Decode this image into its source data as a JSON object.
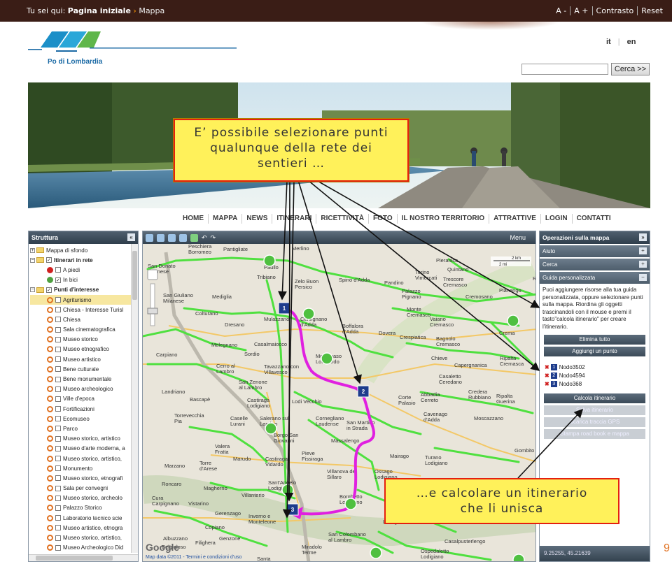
{
  "topbar": {
    "prefix": "Tu sei qui:",
    "home": "Pagina iniziale",
    "sep": "›",
    "current": "Mappa",
    "accessibility": [
      "A -",
      "A +",
      "Contrasto",
      "Reset"
    ]
  },
  "logo": {
    "text": "Po di Lombardia"
  },
  "lang": [
    "it",
    "en"
  ],
  "search": {
    "button": "Cerca >>",
    "value": ""
  },
  "nav": [
    "HOME",
    "MAPPA",
    "NEWS",
    "ITINERARI",
    "RICETTIVITÀ",
    "FOTO",
    "IL NOSTRO TERRITORIO",
    "ATTRATTIVE",
    "LOGIN",
    "CONTATTI"
  ],
  "left": {
    "title": "Struttura",
    "tree": [
      {
        "label": "Mappa di sfondo",
        "level": 0,
        "type": "folder"
      },
      {
        "label": "Itinerari in rete",
        "level": 0,
        "type": "folder-check",
        "bold": true
      },
      {
        "label": "A piedi",
        "level": 1,
        "type": "check"
      },
      {
        "label": "In bici",
        "level": 1,
        "type": "check"
      },
      {
        "label": "Punti d'interesse",
        "level": 0,
        "type": "folder-check",
        "bold": true
      },
      {
        "label": "Agriturismo",
        "level": 1,
        "type": "check",
        "selected": true
      },
      {
        "label": "Chiesa - Interesse Turisl",
        "level": 1,
        "type": "check"
      },
      {
        "label": "Chiesa",
        "level": 1,
        "type": "check"
      },
      {
        "label": "Sala cinematografica",
        "level": 1,
        "type": "check"
      },
      {
        "label": "Museo storico",
        "level": 1,
        "type": "check"
      },
      {
        "label": "Museo etnografico",
        "level": 1,
        "type": "check"
      },
      {
        "label": "Museo artistico",
        "level": 1,
        "type": "check"
      },
      {
        "label": "Bene culturale",
        "level": 1,
        "type": "check"
      },
      {
        "label": "Bene monumentale",
        "level": 1,
        "type": "check"
      },
      {
        "label": "Museo archeologico",
        "level": 1,
        "type": "check"
      },
      {
        "label": "Ville d'epoca",
        "level": 1,
        "type": "check"
      },
      {
        "label": "Fortificazioni",
        "level": 1,
        "type": "check"
      },
      {
        "label": "Ecomuseo",
        "level": 1,
        "type": "check"
      },
      {
        "label": "Parco",
        "level": 1,
        "type": "check"
      },
      {
        "label": "Museo storico, artistico",
        "level": 1,
        "type": "check"
      },
      {
        "label": "Museo d'arte moderna, a",
        "level": 1,
        "type": "check"
      },
      {
        "label": "Museo storico, artistico,",
        "level": 1,
        "type": "check"
      },
      {
        "label": "Monumento",
        "level": 1,
        "type": "check"
      },
      {
        "label": "Museo storico, etnografi",
        "level": 1,
        "type": "check"
      },
      {
        "label": "Sala per convegni",
        "level": 1,
        "type": "check"
      },
      {
        "label": "Museo storico, archeolo",
        "level": 1,
        "type": "check"
      },
      {
        "label": "Palazzo Storico",
        "level": 1,
        "type": "check"
      },
      {
        "label": "Laboratorio tecnico scie",
        "level": 1,
        "type": "check"
      },
      {
        "label": "Museo artistico, etnogra",
        "level": 1,
        "type": "check"
      },
      {
        "label": "Museo storico, artistico,",
        "level": 1,
        "type": "check"
      },
      {
        "label": "Museo Archeologico Did",
        "level": 1,
        "type": "check"
      }
    ]
  },
  "map": {
    "menu": "Menu",
    "towns": [
      [
        "Peschiera Borromeo",
        268,
        354
      ],
      [
        "Pantigliate",
        318,
        358
      ],
      [
        "Merlino",
        416,
        357
      ],
      [
        "San Donato Milanese",
        210,
        382
      ],
      [
        "Paullo",
        376,
        384
      ],
      [
        "Tribiano",
        366,
        398
      ],
      [
        "Zelo Buon Persico",
        420,
        404
      ],
      [
        "Spino d'Adda",
        483,
        402
      ],
      [
        "Pandino",
        548,
        406
      ],
      [
        "Torino Vimercati",
        592,
        391
      ],
      [
        "Pieranica",
        622,
        374
      ],
      [
        "Quintano",
        638,
        387
      ],
      [
        "Palazzo Pignano",
        573,
        418
      ],
      [
        "Trescore Cremasco",
        632,
        401
      ],
      [
        "Cremosano",
        664,
        426
      ],
      [
        "Pianengo",
        712,
        417
      ],
      [
        "Rice",
        760,
        400
      ],
      [
        "San Giuliano Milanese",
        232,
        424
      ],
      [
        "Mediglia",
        302,
        426
      ],
      [
        "Colturano",
        278,
        450
      ],
      [
        "Mulazzano",
        376,
        458
      ],
      [
        "Cervignano d'Adda",
        428,
        458
      ],
      [
        "Boffalora d'Adda",
        488,
        468
      ],
      [
        "Dresano",
        320,
        466
      ],
      [
        "Monte Cremasco",
        580,
        444
      ],
      [
        "Vaiano Cremasco",
        613,
        458
      ],
      [
        "Dovera",
        540,
        478
      ],
      [
        "Crespiatica",
        570,
        484
      ],
      [
        "Bagnolo Cremasco",
        622,
        486
      ],
      [
        "Crema",
        712,
        478
      ],
      [
        "Melegnano",
        301,
        495
      ],
      [
        "Casalmaiocco",
        362,
        494
      ],
      [
        "Sordio",
        348,
        508
      ],
      [
        "Montanaso Lombardo",
        450,
        511
      ],
      [
        "Chieve",
        615,
        514
      ],
      [
        "Capergnanica",
        648,
        524
      ],
      [
        "Ripalta Cremasca",
        713,
        514
      ],
      [
        "Carpiano",
        222,
        509
      ],
      [
        "Cerro al Lambro",
        308,
        525
      ],
      [
        "Tavazzano con Villavesco",
        376,
        526
      ],
      [
        "San Zenone al Lambro",
        340,
        548
      ],
      [
        "Casaletto Ceredano",
        626,
        540
      ],
      [
        "Landriano",
        230,
        562
      ],
      [
        "Bascapè",
        270,
        573
      ],
      [
        "Castiraga Lodigiano",
        352,
        574
      ],
      [
        "Lodi Vecchio",
        416,
        576
      ],
      [
        "Corte Palasio",
        568,
        570
      ],
      [
        "Abbadia Cerreto",
        600,
        566
      ],
      [
        "Credera Rubbiano",
        668,
        562
      ],
      [
        "Ripalta Guerina",
        708,
        568
      ],
      [
        "Torrevecchia Pia",
        248,
        596
      ],
      [
        "Caselle Lurani",
        328,
        600
      ],
      [
        "Salerano sul Lambro",
        370,
        600
      ],
      [
        "Cornegliano Laudense",
        450,
        600
      ],
      [
        "San Martino in Strada",
        494,
        606
      ],
      [
        "Cavenago d'Adda",
        604,
        594
      ],
      [
        "Moscazzano",
        676,
        600
      ],
      [
        "Borgo San Giovanni",
        390,
        624
      ],
      [
        "Valera Fratta",
        306,
        640
      ],
      [
        "Pieve Fissiraga",
        430,
        650
      ],
      [
        "Massalengo",
        472,
        632
      ],
      [
        "Mairago",
        556,
        654
      ],
      [
        "Turano Lodigiano",
        606,
        656
      ],
      [
        "Gombito",
        734,
        646
      ],
      [
        "Marzano",
        234,
        668
      ],
      [
        "Torre d'Arese",
        284,
        664
      ],
      [
        "Marudo",
        332,
        658
      ],
      [
        "Castiraga Vidardo",
        378,
        658
      ],
      [
        "Villanova del Sillaro",
        466,
        676
      ],
      [
        "Ossago Lodigiano",
        534,
        676
      ],
      [
        "Roncaro",
        230,
        694
      ],
      [
        "Magherno",
        290,
        700
      ],
      [
        "Sant'Angelo Lodigiano",
        382,
        692
      ],
      [
        "Villanterio",
        344,
        710
      ],
      [
        "Cura Carpignano",
        216,
        714
      ],
      [
        "Vistarino",
        268,
        722
      ],
      [
        "Gerenzago",
        306,
        736
      ],
      [
        "Inverno e Monteleone",
        354,
        740
      ],
      [
        "Borghetto Lodigiano",
        484,
        712
      ],
      [
        "Livraga",
        546,
        748
      ],
      [
        "Copiano",
        292,
        756
      ],
      [
        "Filighera",
        278,
        778
      ],
      [
        "Genzone",
        312,
        772
      ],
      [
        "San Colombano al Lambro",
        468,
        766
      ],
      [
        "Miradolo Terme",
        430,
        784
      ],
      [
        "Casalpusterlengo",
        634,
        776
      ],
      [
        "Ospedaletto Lodigiano",
        600,
        790
      ],
      [
        "Santa Cristina",
        366,
        801
      ],
      [
        "Albuzzano",
        232,
        772
      ],
      [
        "Belgioioso",
        230,
        784
      ]
    ],
    "google": "Google",
    "mapdata": "Map data ©2011 - Termini e condizioni d'uso",
    "scale": [
      "2 km",
      "2 mi"
    ]
  },
  "right": {
    "title": "Operazioni sulla mappa",
    "sections": [
      "Aiuto",
      "Cerca",
      "Guida personalizzata"
    ],
    "guide_text": "Puoi aggiungere risorse alla tua guida personalizzata, oppure selezionare punti sulla mappa. Riordina gli oggetti trascinandoli con il mouse e premi il tasto\"calcola itinerario\" per creare l'itinerario.",
    "btn_clear": "Elimina tutto",
    "btn_add": "Aggiungi un punto",
    "nodes": [
      {
        "n": "1",
        "label": "Nodo3502"
      },
      {
        "n": "2",
        "label": "Nodo4594"
      },
      {
        "n": "3",
        "label": "Nodo368"
      }
    ],
    "btn_calc": "Calcola itinerario",
    "disabled": [
      "Salva itinerario",
      "Scarica traccia GPS",
      "Stampa road book e mappa"
    ],
    "coords": "9.25255, 45.21639"
  },
  "callout1": [
    "E’ possibile selezionare punti",
    "qualunque della rete dei",
    "sentieri …"
  ],
  "callout2": [
    "…e calcolare un itinerario",
    "che li unisca"
  ],
  "pagenum": "9",
  "colors": {
    "topbar": "#3a1d16",
    "route": "#e020e0",
    "trail": "#4fe03f",
    "callout": "#fff15a",
    "callout_border": "#e4200f"
  }
}
